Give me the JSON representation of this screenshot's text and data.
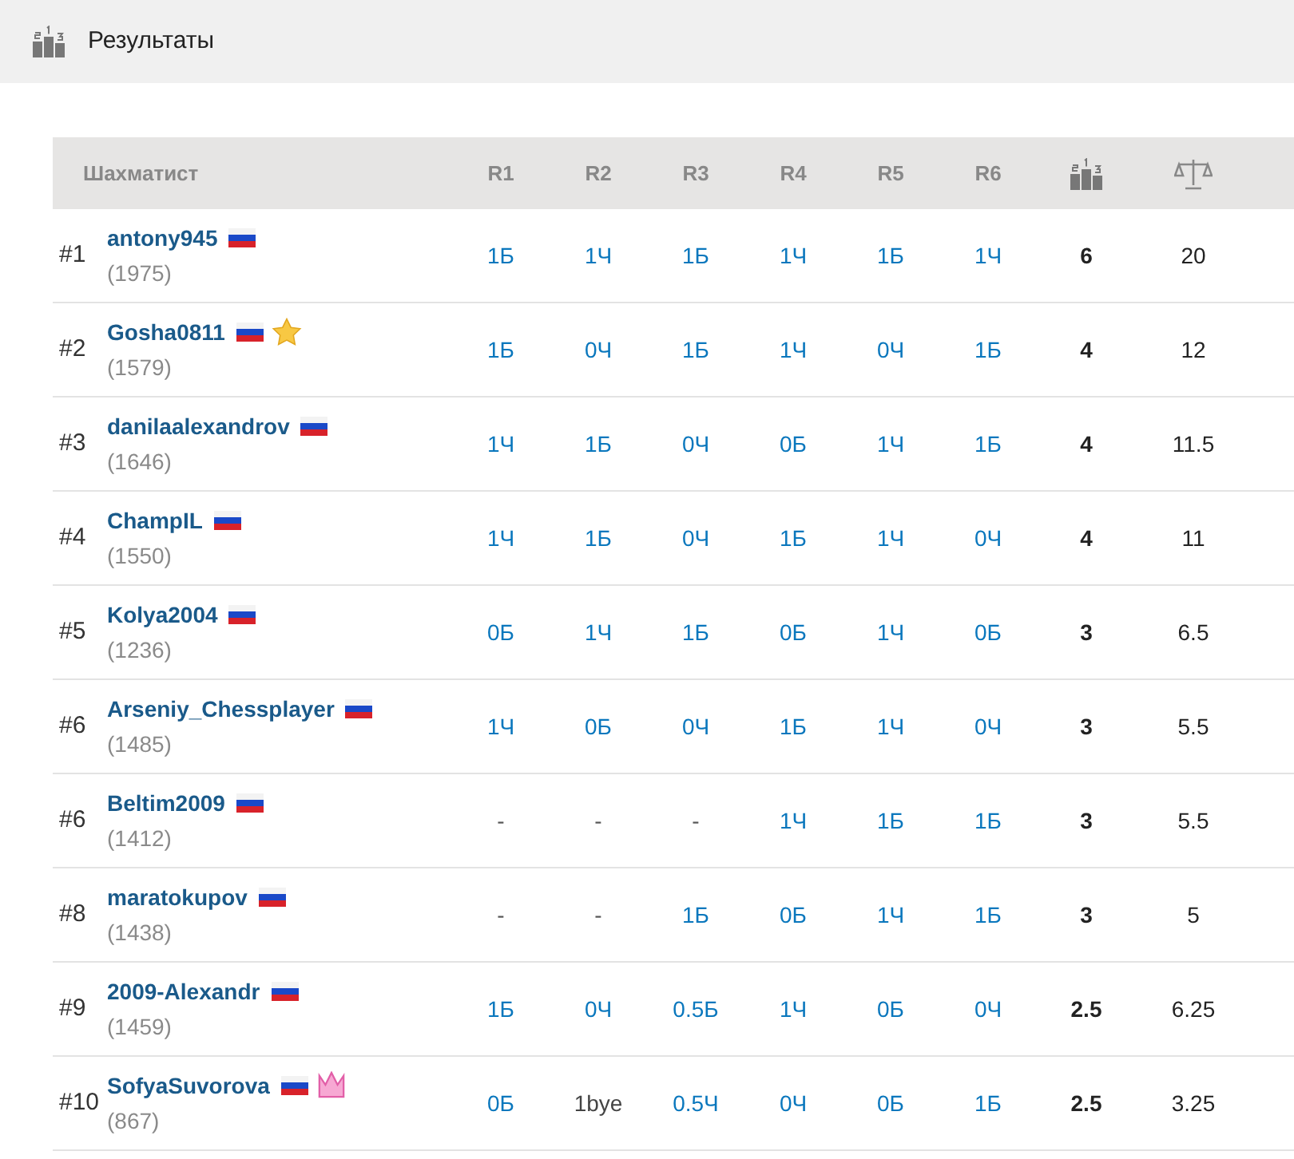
{
  "header": {
    "title": "Результаты"
  },
  "table": {
    "columns": [
      {
        "kind": "text",
        "label": "Шахматист"
      },
      {
        "kind": "text",
        "label": "R1"
      },
      {
        "kind": "text",
        "label": "R2"
      },
      {
        "kind": "text",
        "label": "R3"
      },
      {
        "kind": "text",
        "label": "R4"
      },
      {
        "kind": "text",
        "label": "R5"
      },
      {
        "kind": "text",
        "label": "R6"
      },
      {
        "kind": "podium"
      },
      {
        "kind": "scales"
      }
    ],
    "rows": [
      {
        "rank": "#1",
        "name": "antony945",
        "rating": "(1975)",
        "rounds": [
          {
            "text": "1Б",
            "kind": "game"
          },
          {
            "text": "1Ч",
            "kind": "game"
          },
          {
            "text": "1Б",
            "kind": "game"
          },
          {
            "text": "1Ч",
            "kind": "game"
          },
          {
            "text": "1Б",
            "kind": "game"
          },
          {
            "text": "1Ч",
            "kind": "game"
          }
        ],
        "points": "6",
        "tiebreak": "20"
      },
      {
        "rank": "#2",
        "name": "Gosha0811",
        "rating": "(1579)",
        "badge": {
          "kind": "star"
        },
        "rounds": [
          {
            "text": "1Б",
            "kind": "game"
          },
          {
            "text": "0Ч",
            "kind": "game"
          },
          {
            "text": "1Б",
            "kind": "game"
          },
          {
            "text": "1Ч",
            "kind": "game"
          },
          {
            "text": "0Ч",
            "kind": "game"
          },
          {
            "text": "1Б",
            "kind": "game"
          }
        ],
        "points": "4",
        "tiebreak": "12"
      },
      {
        "rank": "#3",
        "name": "danilaalexandrov",
        "rating": "(1646)",
        "rounds": [
          {
            "text": "1Ч",
            "kind": "game"
          },
          {
            "text": "1Б",
            "kind": "game"
          },
          {
            "text": "0Ч",
            "kind": "game"
          },
          {
            "text": "0Б",
            "kind": "game"
          },
          {
            "text": "1Ч",
            "kind": "game"
          },
          {
            "text": "1Б",
            "kind": "game"
          }
        ],
        "points": "4",
        "tiebreak": "11.5"
      },
      {
        "rank": "#4",
        "name": "ChampIL",
        "rating": "(1550)",
        "rounds": [
          {
            "text": "1Ч",
            "kind": "game"
          },
          {
            "text": "1Б",
            "kind": "game"
          },
          {
            "text": "0Ч",
            "kind": "game"
          },
          {
            "text": "1Б",
            "kind": "game"
          },
          {
            "text": "1Ч",
            "kind": "game"
          },
          {
            "text": "0Ч",
            "kind": "game"
          }
        ],
        "points": "4",
        "tiebreak": "11"
      },
      {
        "rank": "#5",
        "name": "Kolya2004",
        "rating": "(1236)",
        "rounds": [
          {
            "text": "0Б",
            "kind": "game"
          },
          {
            "text": "1Ч",
            "kind": "game"
          },
          {
            "text": "1Б",
            "kind": "game"
          },
          {
            "text": "0Б",
            "kind": "game"
          },
          {
            "text": "1Ч",
            "kind": "game"
          },
          {
            "text": "0Б",
            "kind": "game"
          }
        ],
        "points": "3",
        "tiebreak": "6.5"
      },
      {
        "rank": "#6",
        "name": "Arseniy_Chessplayer",
        "rating": "(1485)",
        "rounds": [
          {
            "text": "1Ч",
            "kind": "game"
          },
          {
            "text": "0Б",
            "kind": "game"
          },
          {
            "text": "0Ч",
            "kind": "game"
          },
          {
            "text": "1Б",
            "kind": "game"
          },
          {
            "text": "1Ч",
            "kind": "game"
          },
          {
            "text": "0Ч",
            "kind": "game"
          }
        ],
        "points": "3",
        "tiebreak": "5.5"
      },
      {
        "rank": "#6",
        "name": "Beltim2009",
        "rating": "(1412)",
        "rounds": [
          {
            "text": "-",
            "kind": "none"
          },
          {
            "text": "-",
            "kind": "none"
          },
          {
            "text": "-",
            "kind": "none"
          },
          {
            "text": "1Ч",
            "kind": "game"
          },
          {
            "text": "1Б",
            "kind": "game"
          },
          {
            "text": "1Б",
            "kind": "game"
          }
        ],
        "points": "3",
        "tiebreak": "5.5"
      },
      {
        "rank": "#8",
        "name": "maratokupov",
        "rating": "(1438)",
        "rounds": [
          {
            "text": "-",
            "kind": "none"
          },
          {
            "text": "-",
            "kind": "none"
          },
          {
            "text": "1Б",
            "kind": "game"
          },
          {
            "text": "0Б",
            "kind": "game"
          },
          {
            "text": "1Ч",
            "kind": "game"
          },
          {
            "text": "1Б",
            "kind": "game"
          }
        ],
        "points": "3",
        "tiebreak": "5"
      },
      {
        "rank": "#9",
        "name": "2009-Alexandr",
        "rating": "(1459)",
        "rounds": [
          {
            "text": "1Б",
            "kind": "game"
          },
          {
            "text": "0Ч",
            "kind": "game"
          },
          {
            "text": "0.5Б",
            "kind": "game"
          },
          {
            "text": "1Ч",
            "kind": "game"
          },
          {
            "text": "0Б",
            "kind": "game"
          },
          {
            "text": "0Ч",
            "kind": "game"
          }
        ],
        "points": "2.5",
        "tiebreak": "6.25"
      },
      {
        "rank": "#10",
        "name": "SofyaSuvorova",
        "rating": "(867)",
        "badge": {
          "kind": "crown"
        },
        "rounds": [
          {
            "text": "0Б",
            "kind": "game"
          },
          {
            "text": "1bye",
            "kind": "bye"
          },
          {
            "text": "0.5Ч",
            "kind": "game"
          },
          {
            "text": "0Ч",
            "kind": "game"
          },
          {
            "text": "0Б",
            "kind": "game"
          },
          {
            "text": "1Б",
            "kind": "game"
          }
        ],
        "points": "2.5",
        "tiebreak": "3.25"
      }
    ]
  }
}
